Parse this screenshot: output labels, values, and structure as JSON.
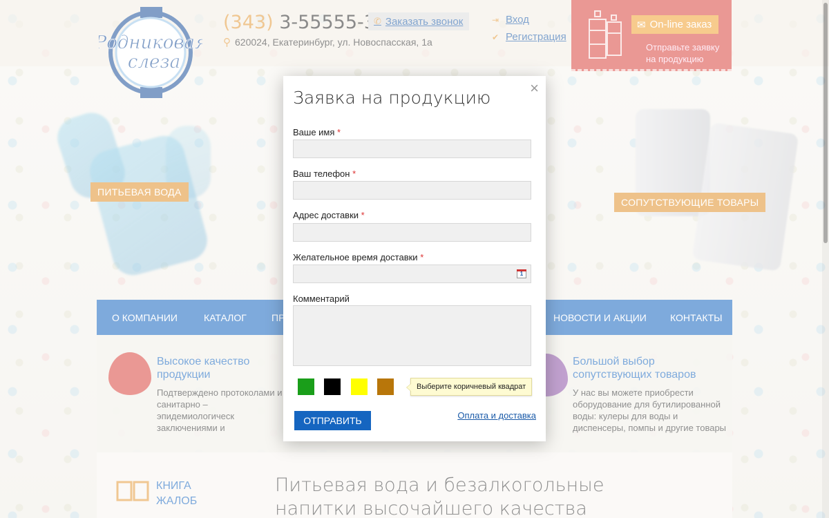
{
  "header": {
    "logo_text": "Родниковая слеза",
    "phone_code": "(343)",
    "phone_number": "3-55555-3",
    "callback_label": "Заказать звонок",
    "address": "620024, Екатеринбург, ул. Новоспасская, 1а",
    "login_label": "Вход",
    "register_label": "Регистрация",
    "online_order_label": "On-line заказ",
    "online_order_hint": "Отправьте заявку на продукцию"
  },
  "hero": {
    "left_label": "ПИТЬЕВАЯ ВОДА",
    "right_label": "СОПУТСТВУЮЩИЕ ТОВАРЫ"
  },
  "nav": {
    "items": [
      "О КОМПАНИИ",
      "КАТАЛОГ",
      "ПР",
      "НОВОСТИ И АКЦИИ",
      "КОНТАКТЫ"
    ]
  },
  "features": [
    {
      "title": "Высокое качество продукции",
      "text": "Подтверждено протоколами и санитарно – эпидемиологическ заключениями и удостоверени о качестве."
    },
    {
      "title": "Большой выбор сопутствующих товаров",
      "text": "У нас вы можете приобрести оборудование для бутилированной воды: кулеры для воды и диспенсеры, помпы и другие товары"
    }
  ],
  "lower": {
    "book_title": "КНИГА ЖАЛОБ",
    "main_heading": "Питьевая вода и безалкогольные напитки высочайшего качества"
  },
  "modal": {
    "title": "Заявка на продукцию",
    "fields": [
      {
        "label": "Ваше имя",
        "required": "*",
        "value": ""
      },
      {
        "label": "Ваш телефон",
        "required": "*",
        "value": ""
      },
      {
        "label": "Адрес доставки",
        "required": "*",
        "value": ""
      },
      {
        "label": "Желательное время доставки",
        "required": "*",
        "value": ""
      }
    ],
    "calendar_icon_text": "1",
    "comment_label": "Комментарий",
    "comment_value": "",
    "captcha_colors": [
      "#1a9e1a",
      "#000000",
      "#ffff00",
      "#b8760a"
    ],
    "captcha_hint": "Выберите коричневый квадрат",
    "submit_label": "ОТПРАВИТЬ",
    "payment_link": "Оплата и доставка",
    "close_symbol": "×"
  },
  "colors": {
    "brand_blue": "#1565c0",
    "accent_orange": "#e0912a",
    "order_red": "#d9443c"
  }
}
